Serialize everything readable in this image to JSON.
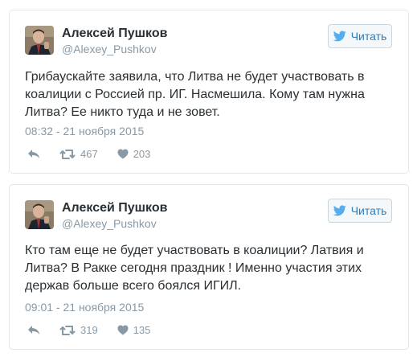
{
  "colors": {
    "name": "#292f33",
    "muted": "#8899a6",
    "link_blue": "#2b7bb9",
    "card_border": "#e1e8ed",
    "button_bg": "#f5f8fa"
  },
  "tweets": [
    {
      "author": {
        "name": "Алексей Пушков",
        "handle": "@Alexey_Pushkov",
        "avatar_icon": "portrait-avatar"
      },
      "follow_label": "Читать",
      "follow_icon": "twitter-bird-icon",
      "text": "Грибаускайте заявила, что Литва не будет участвовать в коалиции с Россией пр. ИГ. Насмешила. Кому там нужна Литва? Ее никто туда и не зовет.",
      "timestamp": "08:32 - 21 ноября 2015",
      "retweets": "467",
      "likes": "203"
    },
    {
      "author": {
        "name": "Алексей Пушков",
        "handle": "@Alexey_Pushkov",
        "avatar_icon": "portrait-avatar"
      },
      "follow_label": "Читать",
      "follow_icon": "twitter-bird-icon",
      "text": "Кто там еще не будет участвовать в коалиции? Латвия и Литва? В Ракке сегодня праздник ! Именно участия этих держав больше всего боялся ИГИЛ.",
      "timestamp": "09:01 - 21 ноября 2015",
      "retweets": "319",
      "likes": "135"
    }
  ]
}
